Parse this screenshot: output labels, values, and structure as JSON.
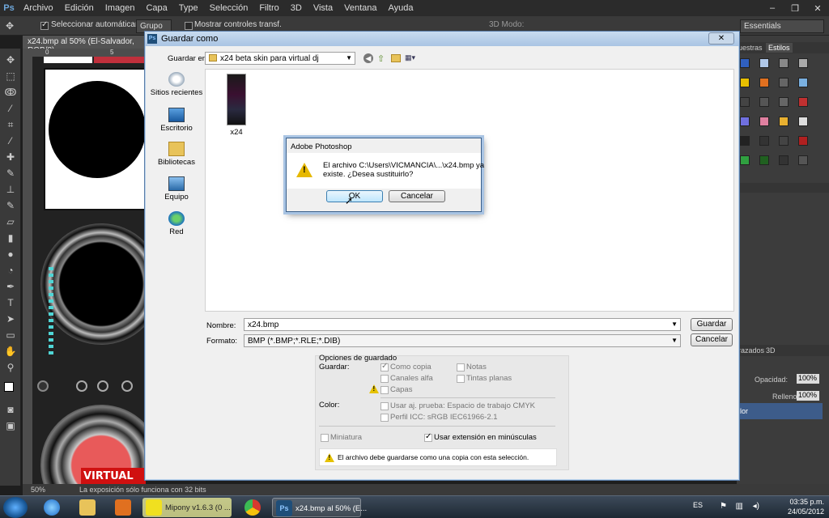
{
  "photoshop": {
    "logo": "Ps",
    "menu": [
      "Archivo",
      "Edición",
      "Imagen",
      "Capa",
      "Type",
      "Selección",
      "Filtro",
      "3D",
      "Vista",
      "Ventana",
      "Ayuda"
    ],
    "options_bar": {
      "auto_select_label": "Seleccionar automáticamente:",
      "auto_select_value": "Grupo",
      "transform_label": "Mostrar controles transf.",
      "mode_label": "3D Modo:",
      "workspace": "Essentials"
    },
    "doc_tab": "x24.bmp al 50% (El-Salvador, RGB/8)",
    "ruler_marks": [
      "0",
      "5"
    ],
    "status": {
      "zoom": "50%",
      "message": "La exposición sólo funciona con 32 bits"
    },
    "panels": {
      "tab_muestras": "uestras",
      "tab_estilos": "Estilos",
      "tab_trazados": "razados",
      "tab_3d": "3D",
      "opacity_label": "Opacidad:",
      "opacity_value": "100%",
      "fill_label": "Relleno:",
      "fill_value": "100%",
      "layer_name": "lor"
    }
  },
  "save_dialog": {
    "title": "Guardar como",
    "close": "✕",
    "save_in_label": "Guardar en:",
    "save_in_value": "x24 beta skin para virtual dj",
    "places": [
      "Sitios recientes",
      "Escritorio",
      "Bibliotecas",
      "Equipo",
      "Red"
    ],
    "files": [
      {
        "name": "x24"
      }
    ],
    "name_label": "Nombre:",
    "name_value": "x24.bmp",
    "format_label": "Formato:",
    "format_value": "BMP (*.BMP;*.RLE;*.DIB)",
    "save_button": "Guardar",
    "cancel_button": "Cancelar",
    "options": {
      "title": "Opciones de guardado",
      "save_label": "Guardar:",
      "como_copia": "Como copia",
      "canales_alfa": "Canales alfa",
      "capas": "Capas",
      "notas": "Notas",
      "tintas_planas": "Tintas planas",
      "color_label": "Color:",
      "usar_prueba": "Usar aj. prueba: Espacio de trabajo CMYK",
      "perfil_icc": "Perfil ICC: sRGB IEC61966-2.1",
      "miniatura": "Miniatura",
      "usar_extension": "Usar extensión en minúsculas",
      "warning": "El archivo debe guardarse como una copia con esta selección."
    }
  },
  "alert": {
    "title": "Adobe Photoshop",
    "message_line1": "El archivo C:\\Users\\VICMANCIA\\...\\x24.bmp ya",
    "message_line2": "existe. ¿Desea sustituirlo?",
    "ok": "OK",
    "cancel": "Cancelar"
  },
  "taskbar": {
    "items": [
      "Mipony v1.6.3 (0 ...",
      "x24.bmp al 50% (E..."
    ],
    "lang": "ES",
    "time": "03:35 p.m.",
    "date": "24/05/2012"
  }
}
